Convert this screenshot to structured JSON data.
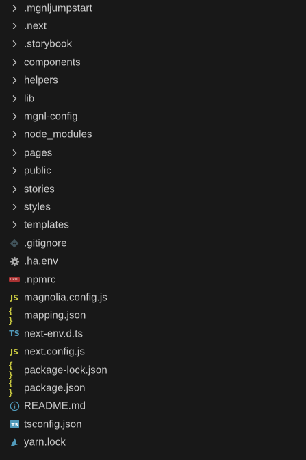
{
  "explorer": {
    "items": [
      {
        "type": "folder",
        "label": ".mgnljumpstart",
        "icon": "chevron-right-icon"
      },
      {
        "type": "folder",
        "label": ".next",
        "icon": "chevron-right-icon"
      },
      {
        "type": "folder",
        "label": ".storybook",
        "icon": "chevron-right-icon"
      },
      {
        "type": "folder",
        "label": "components",
        "icon": "chevron-right-icon"
      },
      {
        "type": "folder",
        "label": "helpers",
        "icon": "chevron-right-icon"
      },
      {
        "type": "folder",
        "label": "lib",
        "icon": "chevron-right-icon"
      },
      {
        "type": "folder",
        "label": "mgnl-config",
        "icon": "chevron-right-icon"
      },
      {
        "type": "folder",
        "label": "node_modules",
        "icon": "chevron-right-icon"
      },
      {
        "type": "folder",
        "label": "pages",
        "icon": "chevron-right-icon"
      },
      {
        "type": "folder",
        "label": "public",
        "icon": "chevron-right-icon"
      },
      {
        "type": "folder",
        "label": "stories",
        "icon": "chevron-right-icon"
      },
      {
        "type": "folder",
        "label": "styles",
        "icon": "chevron-right-icon"
      },
      {
        "type": "folder",
        "label": "templates",
        "icon": "chevron-right-icon"
      },
      {
        "type": "file",
        "label": ".gitignore",
        "icon": "git-icon"
      },
      {
        "type": "file",
        "label": ".ha.env",
        "icon": "gear-icon"
      },
      {
        "type": "file",
        "label": ".npmrc",
        "icon": "npm-icon"
      },
      {
        "type": "file",
        "label": "magnolia.config.js",
        "icon": "javascript-icon"
      },
      {
        "type": "file",
        "label": "mapping.json",
        "icon": "json-icon"
      },
      {
        "type": "file",
        "label": "next-env.d.ts",
        "icon": "typescript-icon"
      },
      {
        "type": "file",
        "label": "next.config.js",
        "icon": "javascript-icon"
      },
      {
        "type": "file",
        "label": "package-lock.json",
        "icon": "json-icon"
      },
      {
        "type": "file",
        "label": "package.json",
        "icon": "json-icon"
      },
      {
        "type": "file",
        "label": "README.md",
        "icon": "info-icon"
      },
      {
        "type": "file",
        "label": "tsconfig.json",
        "icon": "tsconfig-icon"
      },
      {
        "type": "file",
        "label": "yarn.lock",
        "icon": "yarn-icon"
      }
    ]
  },
  "icon_glyphs": {
    "javascript": "JS",
    "json": "{ }",
    "typescript": "TS",
    "npm": "npm",
    "tsconfig": "TS"
  },
  "colors": {
    "background": "#181818",
    "text": "#cccccc",
    "chevron": "#c5c5c5",
    "javascript": "#cbcb41",
    "json": "#cbcb41",
    "typescript": "#519aba",
    "git": "#41535b",
    "gear": "#a9a9a9",
    "npm": "#a83232",
    "info": "#519aba",
    "yarn": "#519aba"
  }
}
